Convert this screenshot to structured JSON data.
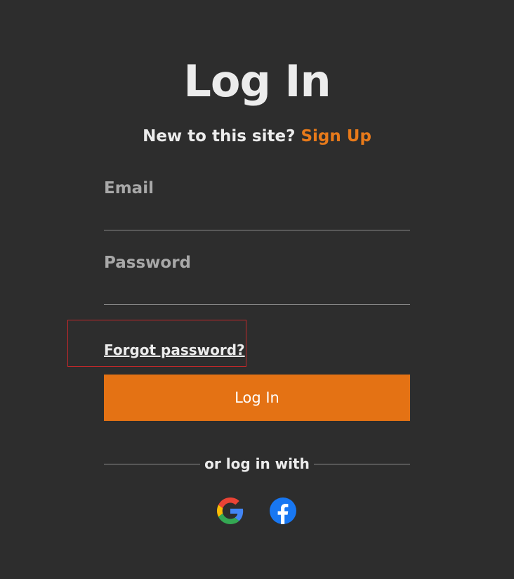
{
  "page": {
    "title": "Log In",
    "subtitle_prefix": "New to this site?",
    "signup_link": "Sign Up"
  },
  "form": {
    "email_label": "Email",
    "email_value": "",
    "password_label": "Password",
    "password_value": "",
    "forgot_password": "Forgot password?",
    "submit_label": "Log In"
  },
  "social": {
    "divider_text": "or log in with",
    "providers": [
      {
        "name": "Google",
        "icon": "google-icon"
      },
      {
        "name": "Facebook",
        "icon": "facebook-icon"
      }
    ]
  },
  "colors": {
    "background": "#2d2d2d",
    "accent": "#e47214",
    "link": "#e87a1a",
    "text": "#ececec",
    "muted": "#a8a8a8",
    "highlight_box": "#c0282a"
  }
}
